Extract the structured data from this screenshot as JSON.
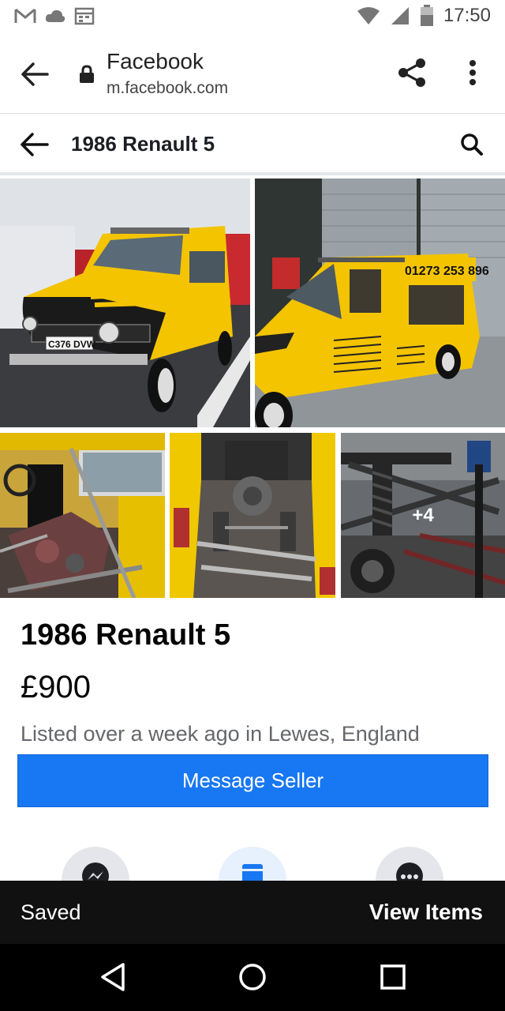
{
  "status_bar": {
    "time": "17:50",
    "left_icons": [
      "gmail-icon",
      "cloud-icon",
      "calendar-icon"
    ],
    "right_icons": [
      "wifi-icon",
      "signal-icon",
      "battery-icon"
    ]
  },
  "browser": {
    "title": "Facebook",
    "url": "m.facebook.com"
  },
  "page": {
    "title": "1986 Renault 5"
  },
  "gallery": {
    "more_count": "+4",
    "photos": [
      {
        "name": "photo-front-van",
        "subject": "yellow van front view",
        "plate": "C376 DVW"
      },
      {
        "name": "photo-side-van",
        "subject": "yellow van side view",
        "phone": "01273 253 896"
      },
      {
        "name": "photo-interior",
        "subject": "interior with engine"
      },
      {
        "name": "photo-rear-engine",
        "subject": "rear view engine bay"
      },
      {
        "name": "photo-chassis",
        "subject": "chassis suspension"
      }
    ]
  },
  "listing": {
    "title": "1986 Renault 5",
    "price": "£900",
    "meta": "Listed over a week ago in Lewes, England",
    "message_button": "Message Seller"
  },
  "actions": [
    {
      "name": "messenger-icon"
    },
    {
      "name": "save-icon"
    },
    {
      "name": "more-options-icon"
    }
  ],
  "saved_bar": {
    "label": "Saved",
    "action": "View Items"
  },
  "nav": [
    "back-nav-icon",
    "home-nav-icon",
    "recents-nav-icon"
  ],
  "colors": {
    "accent": "#1877f2",
    "van_yellow": "#f2c300"
  }
}
